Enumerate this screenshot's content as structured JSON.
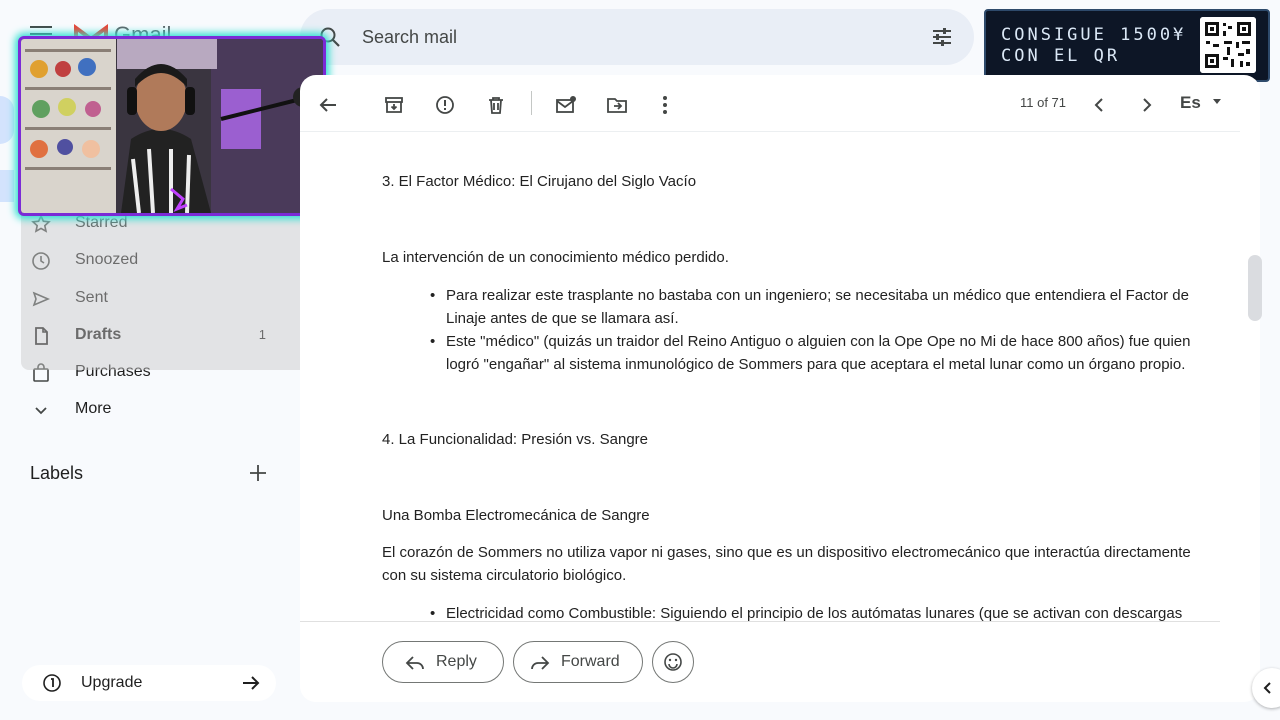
{
  "header": {
    "logo_text": "Gmail",
    "search": {
      "placeholder": "Search mail"
    }
  },
  "promo": {
    "line1": "CONSIGUE 1500¥",
    "line2": "CON EL QR"
  },
  "sidebar": {
    "items": [
      {
        "label": "Starred",
        "icon": "star-icon"
      },
      {
        "label": "Snoozed",
        "icon": "clock-icon"
      },
      {
        "label": "Sent",
        "icon": "send-icon"
      },
      {
        "label": "Drafts",
        "icon": "draft-icon",
        "count": "1"
      },
      {
        "label": "Purchases",
        "icon": "bag-icon"
      },
      {
        "label": "More",
        "icon": "chevron-down-icon"
      }
    ],
    "labels_heading": "Labels",
    "upgrade_label": "Upgrade"
  },
  "toolbar": {
    "pager": "11 of 71",
    "language": "Es"
  },
  "email": {
    "section3_heading": "3. El Factor Médico: El Cirujano del Siglo Vacío",
    "section3_intro": "La intervención de un conocimiento médico perdido.",
    "section3_bullets": [
      "Para realizar este trasplante no bastaba con un ingeniero; se necesitaba un médico que entendiera el Factor de Linaje antes de que se llamara así.",
      "Este \"médico\" (quizás un traidor del Reino Antiguo o alguien con la Ope Ope no Mi de hace 800 años) fue quien logró \"engañar\" al sistema inmunológico de Sommers para que aceptara el metal lunar como un órgano propio."
    ],
    "section4_heading": "4. La Funcionalidad: Presión vs. Sangre",
    "section4_sub": "Una Bomba Electromecánica de Sangre",
    "section4_para": "El corazón de Sommers no utiliza vapor ni gases, sino que es un dispositivo electromecánico que interactúa directamente con su sistema circulatorio biológico.",
    "section4_bullets": [
      "Electricidad como Combustible: Siguiendo el principio de los autómatas lunares (que se activan con descargas"
    ]
  },
  "actions": {
    "reply_label": "Reply",
    "forward_label": "Forward"
  }
}
